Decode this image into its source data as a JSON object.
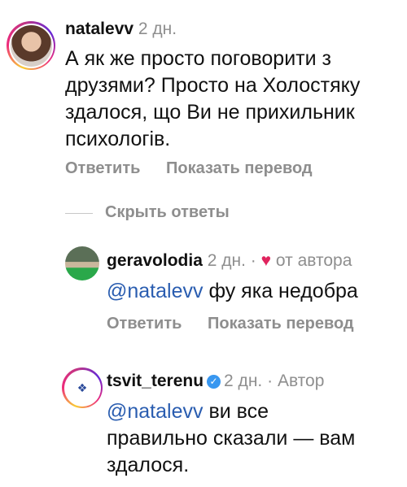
{
  "comments": [
    {
      "username": "natalevv",
      "time": "2 дн.",
      "text": "А як же просто поговорити з друзями? Просто на Холостяку здалося, що Ви не прихильник психологів.",
      "actions": {
        "reply": "Ответить",
        "translate": "Показать перевод"
      }
    }
  ],
  "hide_replies": "Скрыть ответы",
  "replies": [
    {
      "username": "geravolodia",
      "time": "2 дн.",
      "separator": "·",
      "author_badge": "от автора",
      "mention": "@natalevv",
      "text": "фу яка недобра",
      "actions": {
        "reply": "Ответить",
        "translate": "Показать перевод"
      }
    },
    {
      "username": "tsvit_terenu",
      "verified_icon": "verified-badge-icon",
      "time": "2 дн.",
      "separator": "·",
      "author_label": "Автор",
      "mention": "@natalevv",
      "text_line1": "ви все",
      "text_line2": "правильно сказали — вам",
      "text_line3": "здалося."
    }
  ],
  "colors": {
    "mention": "#2a5db0",
    "secondary": "#8e8e8e",
    "heart": "#e0245e",
    "verified": "#3897f0"
  }
}
